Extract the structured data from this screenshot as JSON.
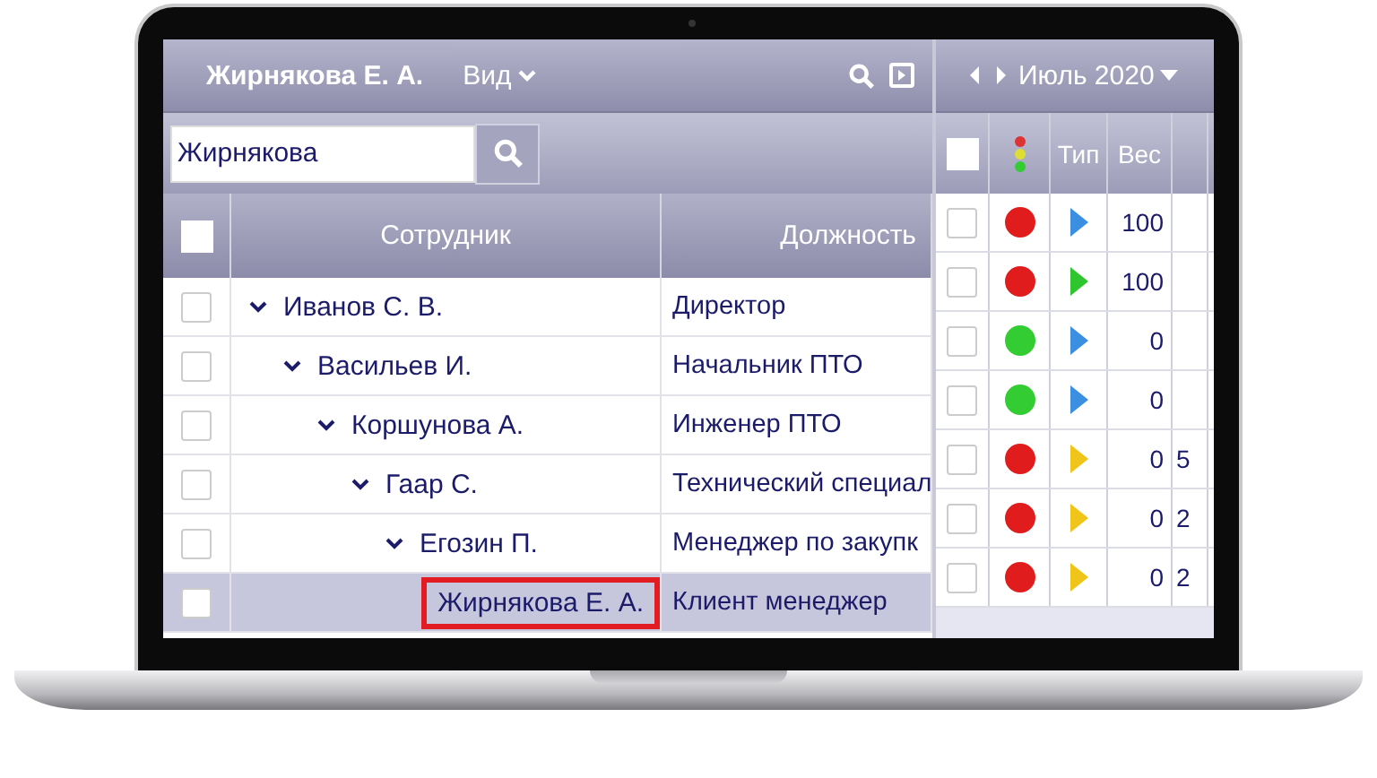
{
  "header": {
    "title": "Жирнякова Е. А.",
    "view_menu": "Вид"
  },
  "search": {
    "value": "Жирнякова"
  },
  "table": {
    "header_checked": false,
    "columns": [
      "Сотрудник",
      "Должность"
    ],
    "rows": [
      {
        "name": "Иванов С. В.",
        "position": "Директор",
        "checked": false,
        "expanded": true,
        "selected": false,
        "children": [
          {
            "name": "Васильев И.",
            "position": "Начальник ПТО",
            "checked": false,
            "expanded": true,
            "selected": false,
            "children": [
              {
                "name": "Коршунова А.",
                "position": "Инженер ПТО",
                "checked": false,
                "expanded": true,
                "selected": false,
                "children": [
                  {
                    "name": "Гаар С.",
                    "position": "Технический специал",
                    "checked": false,
                    "expanded": true,
                    "selected": false,
                    "children": [
                      {
                        "name": "Егозин П.",
                        "position": "Менеджер по закупк",
                        "checked": false,
                        "expanded": true,
                        "selected": false,
                        "children": [
                          {
                            "name": "Жирнякова Е. А.",
                            "position": "Клиент менеджер",
                            "checked": false,
                            "selected": true
                          }
                        ]
                      }
                    ]
                  }
                ]
              }
            ]
          }
        ]
      }
    ]
  },
  "calendar": {
    "month": "Июль 2020",
    "header_checked": false,
    "columns": [
      "Тип",
      "Вес"
    ],
    "rows": [
      {
        "checked": false,
        "status": {
          "color": "#e01c1c"
        },
        "type": {
          "color": "#3b8fe0"
        },
        "weight": "100"
      },
      {
        "checked": false,
        "status": {
          "color": "#e01c1c"
        },
        "type": {
          "color": "#2ec52e"
        },
        "weight": "100"
      },
      {
        "checked": false,
        "status": {
          "color": "#33cc33"
        },
        "type": {
          "color": "#3b8fe0"
        },
        "weight": "0"
      },
      {
        "checked": false,
        "status": {
          "color": "#33cc33"
        },
        "type": {
          "color": "#3b8fe0"
        },
        "weight": "0"
      },
      {
        "checked": false,
        "status": {
          "color": "#e01c1c"
        },
        "type": {
          "color": "#f0c419"
        },
        "weight": "0",
        "column_5": "5"
      },
      {
        "checked": false,
        "status": {
          "color": "#e01c1c"
        },
        "type": {
          "color": "#f0c419"
        },
        "weight": "0",
        "column_5": "2"
      },
      {
        "checked": false,
        "status": {
          "color": "#e01c1c"
        },
        "type": {
          "color": "#f0c419"
        },
        "weight": "0",
        "column_5": "2"
      }
    ]
  }
}
